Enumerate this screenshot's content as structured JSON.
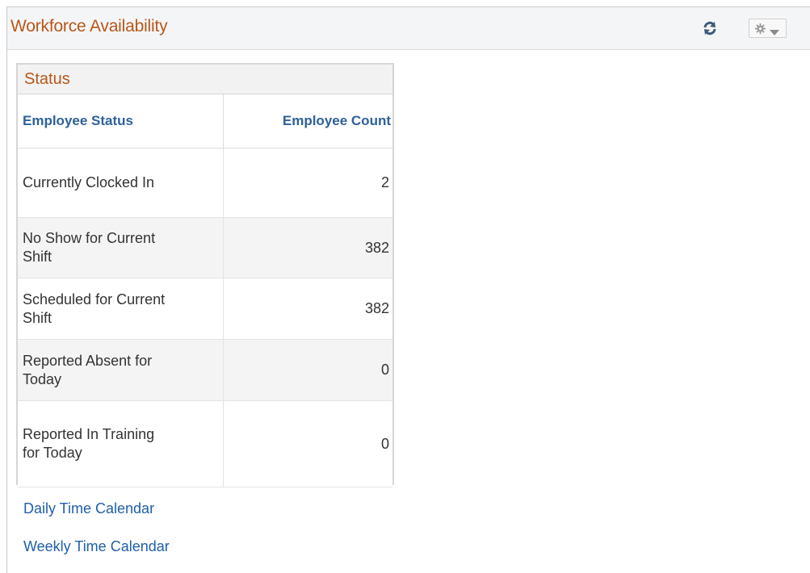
{
  "pagelet": {
    "title": "Workforce Availability",
    "refresh_icon": "refresh-icon",
    "actions_icon": "gear-icon"
  },
  "status": {
    "title": "Status",
    "columns": [
      "Employee Status",
      "Employee Count"
    ],
    "rows": [
      {
        "label_lines": [
          "Currently Clocked In"
        ],
        "count": "2"
      },
      {
        "label_lines": [
          "No Show for Current",
          "Shift"
        ],
        "count": "382"
      },
      {
        "label_lines": [
          "Scheduled for Current",
          "Shift"
        ],
        "count": "382"
      },
      {
        "label_lines": [
          "Reported Absent for",
          "Today"
        ],
        "count": "0"
      },
      {
        "label_lines": [
          "Reported In Training",
          "for Today"
        ],
        "count": "0"
      }
    ]
  },
  "links": {
    "daily": "Daily Time Calendar",
    "weekly": "Weekly Time Calendar"
  },
  "colors": {
    "title": "#b6581b",
    "header_text": "#2e6199",
    "link": "#1f5fa8"
  }
}
